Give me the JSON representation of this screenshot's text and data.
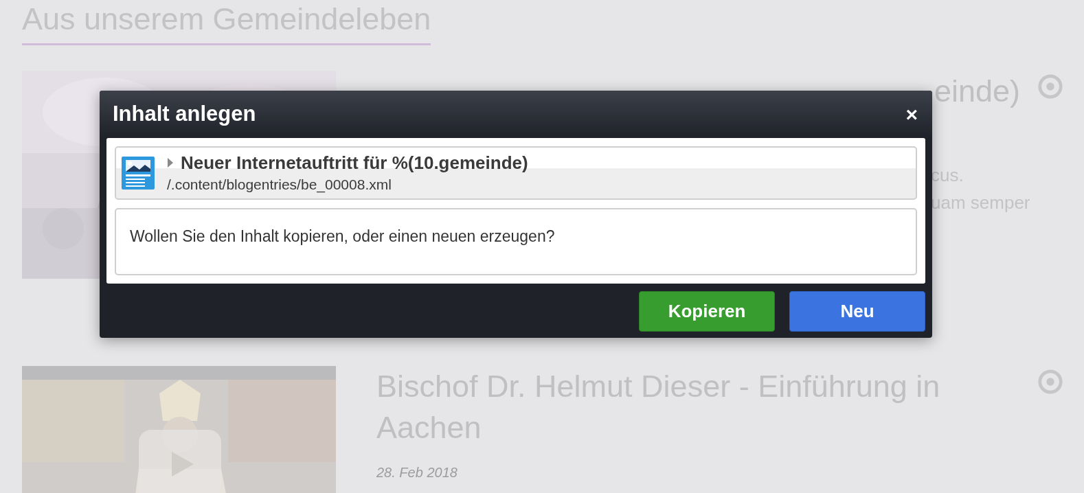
{
  "page": {
    "heading": "Aus unserem Gemeindeleben",
    "articles": [
      {
        "title": "einde)",
        "title_cut": true,
        "excerpt_lines": [
          "cus.",
          "uam semper"
        ],
        "video": false
      },
      {
        "title": "Bischof Dr. Helmut Dieser - Einführung in Aachen",
        "title_cut": false,
        "date": "28. Feb 2018",
        "video": true
      }
    ]
  },
  "dialog": {
    "title": "Inhalt anlegen",
    "close": "×",
    "resource": {
      "title": "Neuer Internetauftritt für %(10.gemeinde)",
      "path": "/.content/blogentries/be_00008.xml",
      "expanded": false
    },
    "message": "Wollen Sie den Inhalt kopieren, oder einen neuen erzeugen?",
    "buttons": [
      {
        "label": "Kopieren",
        "kind": "copy"
      },
      {
        "label": "Neu",
        "kind": "new"
      }
    ]
  }
}
